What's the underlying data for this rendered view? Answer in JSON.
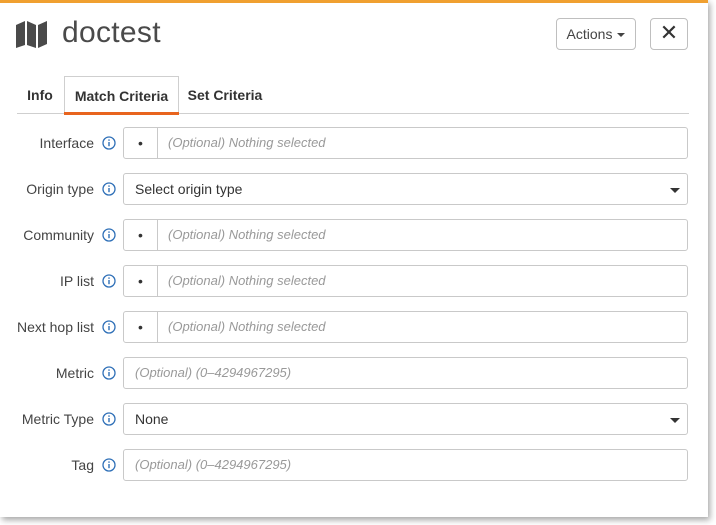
{
  "header": {
    "title": "doctest",
    "icon": "map-icon",
    "actions_label": "Actions",
    "close_glyph": "✕"
  },
  "tabs": [
    {
      "label": "Info",
      "active": false
    },
    {
      "label": "Match Criteria",
      "active": true
    },
    {
      "label": "Set Criteria",
      "active": false
    }
  ],
  "form": {
    "interface": {
      "label": "Interface",
      "placeholder": "(Optional) Nothing selected",
      "dot": "•"
    },
    "origin_type": {
      "label": "Origin type",
      "value": "Select origin type"
    },
    "community": {
      "label": "Community",
      "placeholder": "(Optional) Nothing selected",
      "dot": "•"
    },
    "ip_list": {
      "label": "IP list",
      "placeholder": "(Optional) Nothing selected",
      "dot": "•"
    },
    "next_hop_list": {
      "label": "Next hop list",
      "placeholder": "(Optional) Nothing selected",
      "dot": "•"
    },
    "metric": {
      "label": "Metric",
      "placeholder": "(Optional) (0–4294967295)"
    },
    "metric_type": {
      "label": "Metric Type",
      "value": "None"
    },
    "tag": {
      "label": "Tag",
      "placeholder": "(Optional) (0–4294967295)"
    }
  },
  "colors": {
    "accent_top_border": "#f0a030",
    "active_tab_underline": "#e8641e",
    "info_icon": "#2e6fb7"
  }
}
